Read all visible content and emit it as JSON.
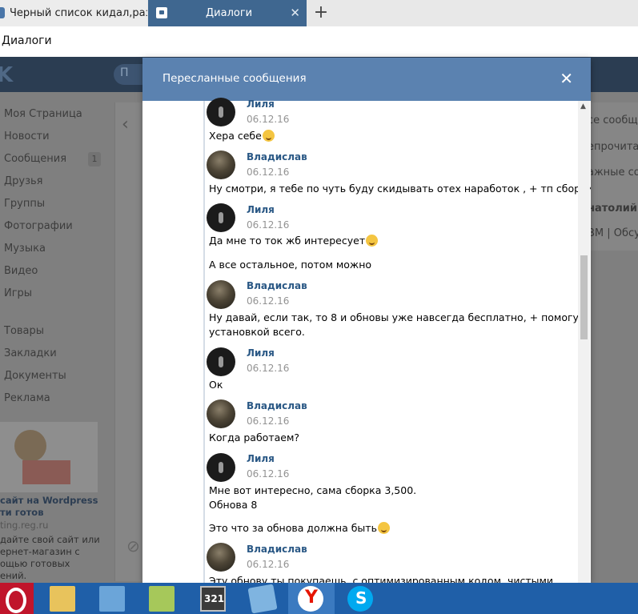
{
  "browser": {
    "tabs": [
      {
        "label": "Черный список кидал,разво"
      },
      {
        "label": "Диалоги"
      }
    ],
    "new_tab": "+",
    "close_tab": "✕",
    "address": "Диалоги"
  },
  "vk": {
    "logo": "K",
    "search_placeholder": "П",
    "sidebar": [
      {
        "label": "Моя Страница"
      },
      {
        "label": "Новости"
      },
      {
        "label": "Сообщения",
        "count": "1"
      },
      {
        "label": "Друзья"
      },
      {
        "label": "Группы"
      },
      {
        "label": "Фотографии"
      },
      {
        "label": "Музыка"
      },
      {
        "label": "Видео"
      },
      {
        "label": "Игры"
      },
      {
        "label": "Товары"
      },
      {
        "label": "Закладки"
      },
      {
        "label": "Документы"
      },
      {
        "label": "Реклама"
      }
    ],
    "ad": {
      "title1": "сайт на Wordpress",
      "title2": "ти готов",
      "domain": "ting.reg.ru",
      "line1": "дайте свой сайт или",
      "line2": "ернет-магазин с",
      "line3": "ощью готовых",
      "line4": "ений."
    },
    "right_menu": [
      "се сообще",
      "епрочитан",
      "ажные сос",
      "натолий Б",
      "ВМ | Обсуж"
    ]
  },
  "modal": {
    "title": "Пересланные сообщения",
    "close": "✕",
    "messages": [
      {
        "author": "Лиля",
        "date": "06.12.16",
        "lines": [
          "Хера себе"
        ],
        "emoji": true
      },
      {
        "author": "Владислав",
        "date": "06.12.16",
        "lines": [
          "Ну смотри, я тебе по чуть буду скидывать отех наработок , + тп сборки"
        ]
      },
      {
        "author": "Лиля",
        "date": "06.12.16",
        "lines": [
          "Да мне то ток жб интересует"
        ],
        "emoji": true
      },
      {
        "author": "",
        "date": "",
        "lines": [
          "А все остальное, потом можно"
        ]
      },
      {
        "author": "Владислав",
        "date": "06.12.16",
        "lines": [
          "Ну давай, если так, то 8 и обновы уже навсегда бесплатно, + помогу с",
          "установкой всего."
        ]
      },
      {
        "author": "Лиля",
        "date": "06.12.16",
        "lines": [
          "Ок"
        ]
      },
      {
        "author": "Владислав",
        "date": "06.12.16",
        "lines": [
          "Когда работаем?"
        ]
      },
      {
        "author": "Лиля",
        "date": "06.12.16",
        "lines": [
          "Мне вот интересно, сама сборка 3,500.",
          "Обнова 8"
        ]
      },
      {
        "author": "",
        "date": "",
        "lines": [
          "Это что за обнова должна быть"
        ],
        "emoji": true
      },
      {
        "author": "Владислав",
        "date": "06.12.16",
        "lines": [
          "Эту обнову ты покупаешь, с оптимизированным кодом, чистыми"
        ]
      }
    ]
  },
  "taskbar": {
    "items": [
      "opera",
      "file-manager",
      "control-panel",
      "notepad",
      "media-player",
      "notes",
      "yandex-browser",
      "skype"
    ],
    "player_label": "321",
    "yandex_label": "Y",
    "skype_label": "S"
  }
}
